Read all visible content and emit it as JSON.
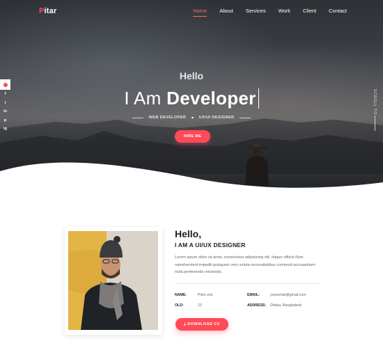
{
  "brand": {
    "logo_first": "P",
    "logo_rest": "itar",
    "accent_color": "#ff4a57"
  },
  "nav": {
    "items": [
      "Home",
      "About",
      "Services",
      "Work",
      "Client",
      "Contact"
    ],
    "active": "Home"
  },
  "hero": {
    "greeting": "Hello",
    "headline_prefix": "I Am ",
    "headline_strong": "Developer",
    "role_1": "WEB DEVELOPER",
    "role_2": "UX/UI DESIGNER",
    "cta": "HIRE ME",
    "scroll_label": "SCROLL TO"
  },
  "social": {
    "icons": [
      "settings-dot-icon",
      "facebook-icon",
      "twitter-icon",
      "linkedin-icon",
      "pinterest-icon",
      "instagram-icon"
    ],
    "glyphs": [
      "f",
      "t",
      "in",
      "p",
      "ig"
    ]
  },
  "about": {
    "greeting": "Hello,",
    "subtitle": "I AM A UI/UX DESIGNER",
    "paragraph": "Lorem ipsum dolor sit amet, consectetur adipisicing elit. Itaque officiis illum reprehenderit impedit quisquam vero soluta necessitatibus commodi accusantium nulla perferendis reiciendis.",
    "name_label": "NAME:",
    "name_value": "Piton son",
    "old_label": "OLD:",
    "old_value": "23",
    "email_label": "EMAIL:",
    "email_value": "youremail@gmail.com",
    "address_label": "ADDRESS:",
    "address_value": "Dhaka, Bangladesh",
    "download_label": "DOWNLOAD CV"
  }
}
